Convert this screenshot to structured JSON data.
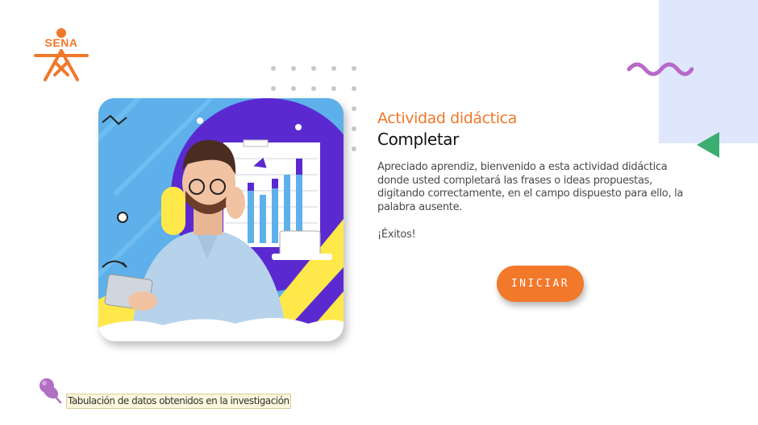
{
  "brand": {
    "logo_text": "SENA",
    "logo_color": "#f0782a"
  },
  "decor": {
    "squiggle_color": "#b76ac8",
    "triangle_color": "#3cae72",
    "panel_color": "#dfe7fd",
    "dots_color": "#c8c8c8"
  },
  "hero": {
    "image": "man-with-tablet-and-charts-illustration"
  },
  "content": {
    "eyebrow": "Actividad didáctica",
    "title": "Completar",
    "description": "Apreciado aprendiz, bienvenido a esta actividad didáctica donde usted completará las frases o ideas propuestas, digitando correctamente, en el campo dispuesto para ello, la palabra ausente.",
    "cheer": "¡Éxitos!"
  },
  "actions": {
    "start_label": "INICIAR",
    "start_color": "#f2782a"
  },
  "footer": {
    "pin_icon": "pushpin-icon",
    "caption": "Tabulación de datos obtenidos en la investigación"
  }
}
